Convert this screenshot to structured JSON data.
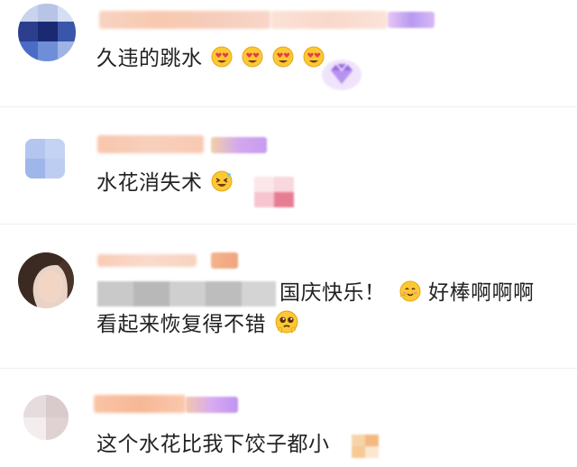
{
  "comments": [
    {
      "text": "久违的跳水",
      "emoji_icons": [
        "heart-eyes-icon",
        "heart-eyes-icon",
        "heart-eyes-icon",
        "heart-eyes-icon"
      ]
    },
    {
      "text": "水花消失术",
      "emoji_icons": [
        "laughing-face-icon"
      ]
    },
    {
      "line1_text": "国庆快乐！",
      "line1_suffix": "好棒啊啊啊",
      "line2_text": "看起来恢复得不错",
      "emoji_icons": [
        "smiling-face-icon",
        "pleading-face-icon"
      ]
    },
    {
      "text": "这个水花比我下饺子都小",
      "emoji_icons": [
        "hand-icon"
      ]
    }
  ],
  "colors": {
    "name_blur": "#f7c4a9",
    "badge_purple": "#c9a7f2",
    "text": "#222222",
    "divider": "#efefef"
  }
}
